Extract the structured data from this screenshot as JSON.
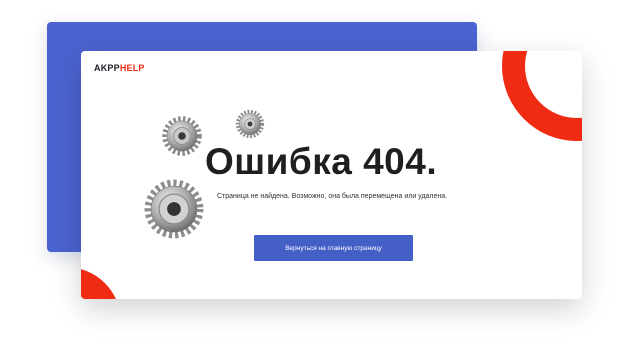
{
  "brand": {
    "logo_part1": "AKPP",
    "logo_part2": "HELP"
  },
  "error": {
    "title": "Ошибка 404.",
    "message": "Страница не найдена. Возможно, она была перемещена или удалена."
  },
  "actions": {
    "home_button_label": "Вернуться на главную страницу"
  },
  "decor": {
    "icons": [
      "gear-icon",
      "gear-icon",
      "gear-icon"
    ],
    "colors": {
      "accent_blue": "#4b63d0",
      "button_blue": "#4460c6",
      "accent_red": "#f02b14",
      "title_text": "#1f1f1f"
    }
  }
}
